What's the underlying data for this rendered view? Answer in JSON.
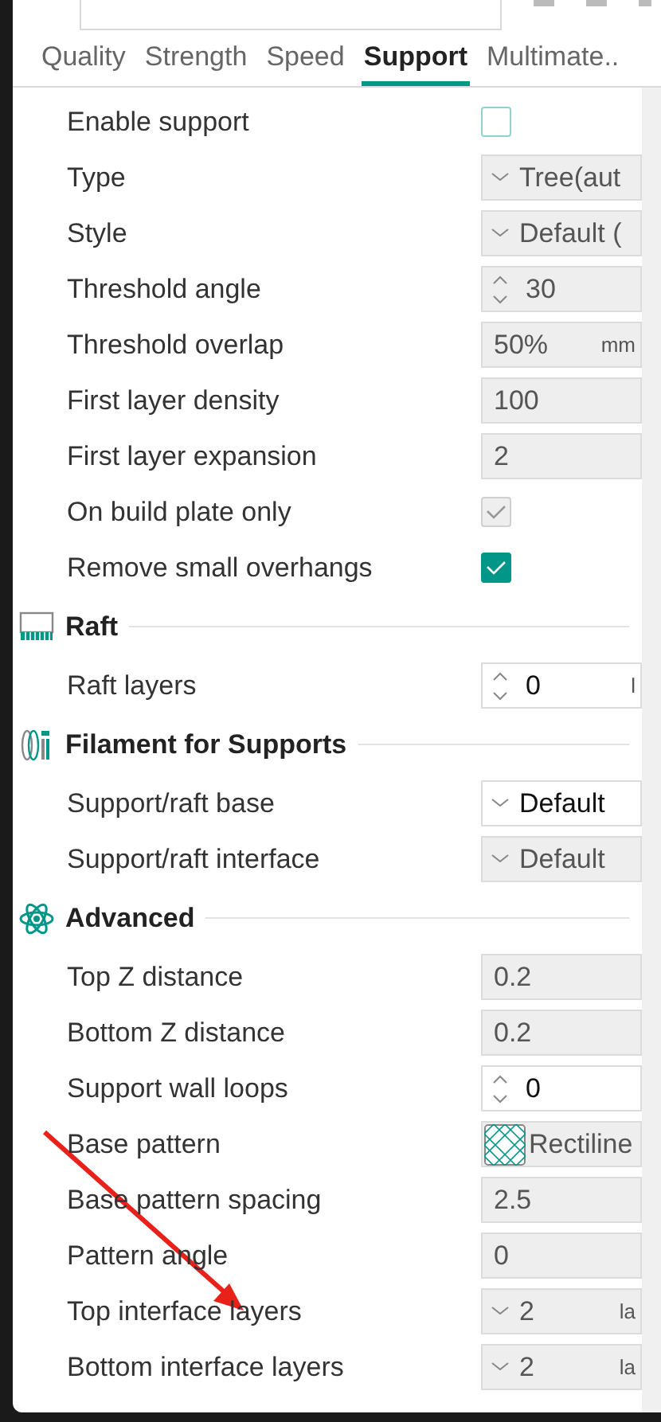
{
  "tabs": [
    {
      "label": "Quality",
      "selected": false
    },
    {
      "label": "Strength",
      "selected": false
    },
    {
      "label": "Speed",
      "selected": false
    },
    {
      "label": "Support",
      "selected": true
    },
    {
      "label": "Multimate..",
      "selected": false
    }
  ],
  "sections": [
    {
      "rows": [
        {
          "label": "Enable support",
          "kind": "checkbox",
          "checked": false,
          "disabled": false
        },
        {
          "label": "Type",
          "kind": "select",
          "value": "Tree(aut",
          "disabled": true
        },
        {
          "label": "Style",
          "kind": "select",
          "value": "Default (",
          "disabled": true
        },
        {
          "label": "Threshold angle",
          "kind": "spin",
          "value": "30",
          "disabled": true
        },
        {
          "label": "Threshold overlap",
          "kind": "text",
          "value": "50%",
          "unit": "mm",
          "disabled": true
        },
        {
          "label": "First layer density",
          "kind": "text",
          "value": "100",
          "disabled": true
        },
        {
          "label": "First layer expansion",
          "kind": "text",
          "value": "2",
          "disabled": true
        },
        {
          "label": "On build plate only",
          "kind": "checkbox",
          "checked": true,
          "disabled": true
        },
        {
          "label": "Remove small overhangs",
          "kind": "checkbox",
          "checked": true,
          "disabled": false
        }
      ]
    },
    {
      "title": "Raft",
      "rows": [
        {
          "label": "Raft layers",
          "kind": "spin",
          "value": "0",
          "unit": "l",
          "disabled": false
        }
      ]
    },
    {
      "title": "Filament for Supports",
      "rows": [
        {
          "label": "Support/raft base",
          "kind": "select",
          "value": "Default",
          "disabled": false
        },
        {
          "label": "Support/raft interface",
          "kind": "select",
          "value": "Default",
          "disabled": true
        }
      ]
    },
    {
      "title": "Advanced",
      "rows": [
        {
          "label": "Top Z distance",
          "kind": "text",
          "value": "0.2",
          "disabled": true
        },
        {
          "label": "Bottom Z distance",
          "kind": "text",
          "value": "0.2",
          "disabled": true
        },
        {
          "label": "Support wall loops",
          "kind": "spin",
          "value": "0",
          "disabled": false
        },
        {
          "label": "Base pattern",
          "kind": "pattern",
          "value": "Rectiline",
          "disabled": true
        },
        {
          "label": "Base pattern spacing",
          "kind": "text",
          "value": "2.5",
          "disabled": true
        },
        {
          "label": "Pattern angle",
          "kind": "text",
          "value": "0",
          "disabled": true
        },
        {
          "label": "Top interface layers",
          "kind": "select",
          "value": "2",
          "unit": "la",
          "disabled": true
        },
        {
          "label": "Bottom interface layers",
          "kind": "select",
          "value": "2",
          "unit": "la",
          "disabled": true
        }
      ]
    }
  ]
}
